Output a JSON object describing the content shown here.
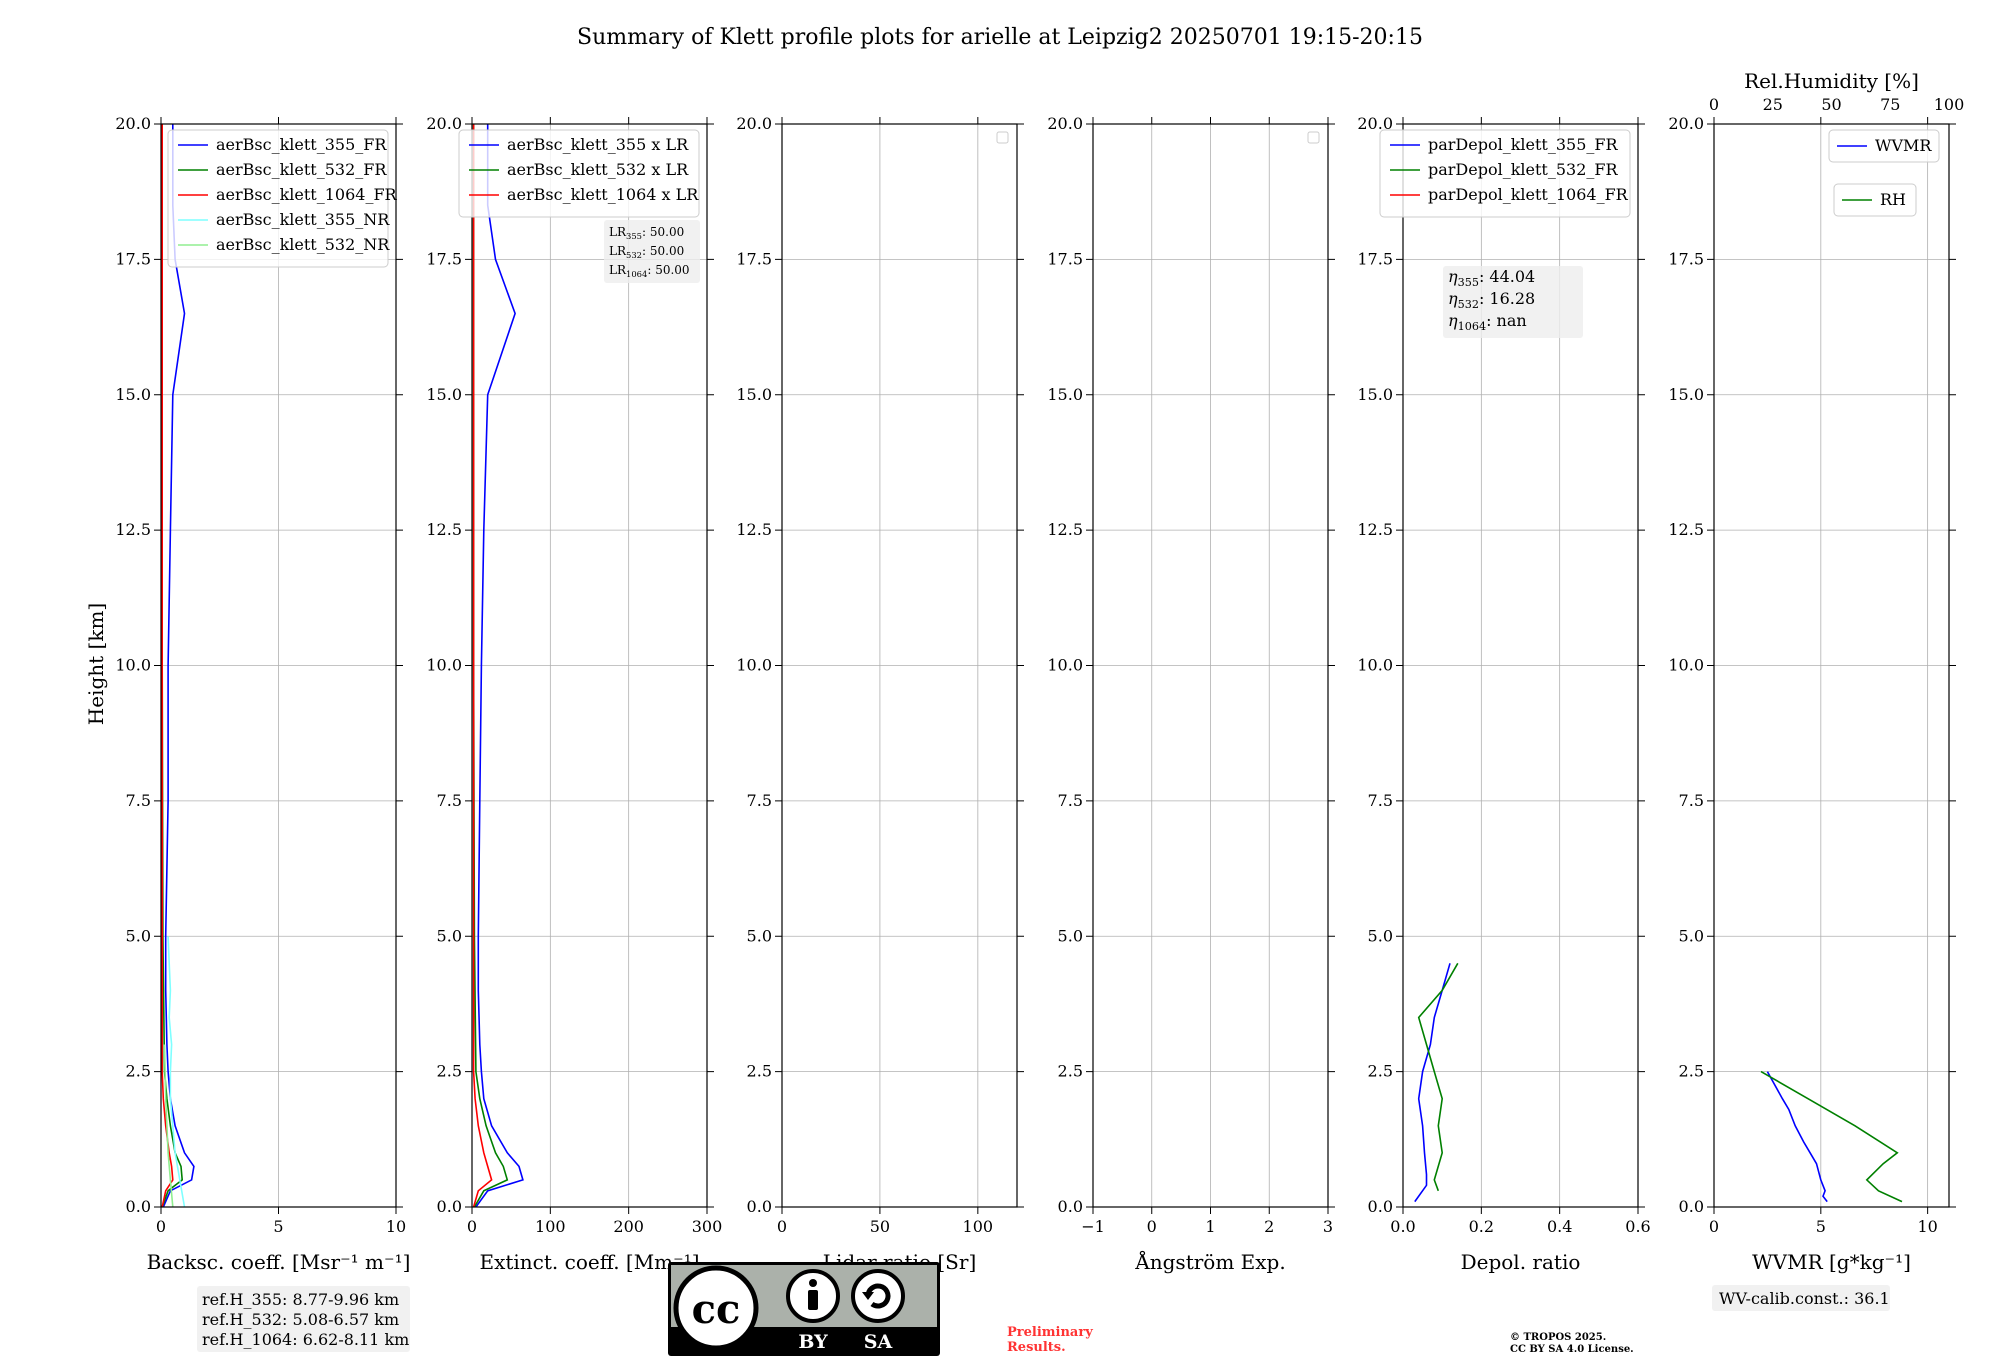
{
  "title": "Summary of Klett profile plots for arielle at Leipzig2 20250701 19:15-20:15",
  "ylabel": "Height [km]",
  "y_ticks": [
    "0.0",
    "2.5",
    "5.0",
    "7.5",
    "10.0",
    "12.5",
    "15.0",
    "17.5",
    "20.0"
  ],
  "colors": {
    "c355": "#0000ff",
    "c532": "#008000",
    "c1064": "#ff0000",
    "c355nr": "#7fffff",
    "c532nr": "#90ee90",
    "wvmr": "#0000ff",
    "rh": "#008000"
  },
  "chart_data": [
    {
      "type": "line",
      "id": "bsc",
      "xlabel": "Backsc. coeff. [Msr⁻¹ m⁻¹]",
      "xlim": [
        0,
        10
      ],
      "ylim": [
        0,
        20
      ],
      "x_ticks": [
        "0",
        "5",
        "10"
      ],
      "legend": "top-right",
      "series": [
        {
          "name": "aerBsc_klett_355_FR",
          "color": "#0000ff",
          "y": [
            0.0,
            0.3,
            0.5,
            0.75,
            1.0,
            1.5,
            2.0,
            2.5,
            3.0,
            4.0,
            5.0,
            7.5,
            10.0,
            12.5,
            15.0,
            16.5,
            17.5,
            18.5,
            20.0
          ],
          "x": [
            0.1,
            0.4,
            1.3,
            1.4,
            1.0,
            0.6,
            0.4,
            0.3,
            0.25,
            0.2,
            0.2,
            0.3,
            0.3,
            0.4,
            0.5,
            1.0,
            0.6,
            0.5,
            0.5
          ]
        },
        {
          "name": "aerBsc_klett_532_FR",
          "color": "#008000",
          "y": [
            0.0,
            0.3,
            0.5,
            0.75,
            1.0,
            1.5,
            2.0,
            2.5,
            5.0,
            10.0,
            15.0,
            20.0
          ],
          "x": [
            0.05,
            0.3,
            0.9,
            0.85,
            0.6,
            0.4,
            0.25,
            0.15,
            0.08,
            0.05,
            0.05,
            0.05
          ]
        },
        {
          "name": "aerBsc_klett_1064_FR",
          "color": "#ff0000",
          "y": [
            0.0,
            0.3,
            0.5,
            0.75,
            1.0,
            1.5,
            2.0,
            2.5,
            5.0,
            10.0,
            15.0,
            20.0
          ],
          "x": [
            0.05,
            0.2,
            0.5,
            0.45,
            0.35,
            0.2,
            0.1,
            0.05,
            0.05,
            0.05,
            0.05,
            0.05
          ]
        },
        {
          "name": "aerBsc_klett_355_NR",
          "color": "#7fffff",
          "y": [
            0.0,
            0.5,
            1.0,
            2.0,
            2.5,
            3.0,
            3.5,
            4.0,
            4.5,
            5.0
          ],
          "x": [
            1.0,
            0.8,
            0.6,
            0.4,
            0.4,
            0.45,
            0.35,
            0.4,
            0.35,
            0.3
          ]
        },
        {
          "name": "aerBsc_klett_532_NR",
          "color": "#90ee90",
          "y": [
            0.0,
            0.5,
            1.0,
            2.0,
            3.0
          ],
          "x": [
            0.5,
            0.4,
            0.3,
            0.2,
            0.15
          ]
        }
      ]
    },
    {
      "type": "line",
      "id": "ext",
      "xlabel": "Extinct. coeff. [Mm⁻¹]",
      "xlim": [
        0,
        300
      ],
      "ylim": [
        0,
        20
      ],
      "x_ticks": [
        "0",
        "100",
        "200",
        "300"
      ],
      "legend": "top-right",
      "series": [
        {
          "name": "aerBsc_klett_355 x LR",
          "color": "#0000ff",
          "y": [
            0.0,
            0.3,
            0.5,
            0.75,
            1.0,
            1.5,
            2.0,
            2.5,
            3.0,
            4.0,
            5.0,
            7.5,
            10.0,
            12.5,
            15.0,
            16.5,
            17.5,
            18.5,
            20.0
          ],
          "x": [
            5,
            20,
            65,
            60,
            45,
            25,
            15,
            12,
            10,
            8,
            8,
            10,
            12,
            15,
            20,
            55,
            30,
            20,
            20
          ]
        },
        {
          "name": "aerBsc_klett_532 x LR",
          "color": "#008000",
          "y": [
            0.0,
            0.3,
            0.5,
            0.75,
            1.0,
            1.5,
            2.0,
            2.5,
            5.0,
            10.0,
            15.0,
            20.0
          ],
          "x": [
            3,
            15,
            45,
            40,
            30,
            18,
            10,
            5,
            3,
            2,
            2,
            2
          ]
        },
        {
          "name": "aerBsc_klett_1064 x LR",
          "color": "#ff0000",
          "y": [
            0.0,
            0.3,
            0.5,
            0.75,
            1.0,
            1.5,
            2.0,
            2.5,
            5.0,
            10.0,
            15.0,
            20.0
          ],
          "x": [
            2,
            8,
            25,
            20,
            15,
            8,
            4,
            2,
            2,
            2,
            2,
            2
          ]
        }
      ],
      "annotation": [
        {
          "label": "LR",
          "sub": "355",
          "value": ": 50.00"
        },
        {
          "label": "LR",
          "sub": "532",
          "value": ": 50.00"
        },
        {
          "label": "LR",
          "sub": "1064",
          "value": ": 50.00"
        }
      ]
    },
    {
      "type": "line",
      "id": "lr",
      "xlabel": "Lidar ratio [Sr]",
      "xlim": [
        0,
        120
      ],
      "ylim": [
        0,
        20
      ],
      "x_ticks": [
        "0",
        "50",
        "100"
      ],
      "series": []
    },
    {
      "type": "line",
      "id": "ang",
      "xlabel": "Ångström Exp.",
      "xlim": [
        -1,
        3
      ],
      "ylim": [
        0,
        20
      ],
      "x_ticks": [
        "−1",
        "0",
        "1",
        "2",
        "3"
      ],
      "series": []
    },
    {
      "type": "line",
      "id": "dep",
      "xlabel": "Depol. ratio",
      "xlim": [
        0,
        0.6
      ],
      "ylim": [
        0,
        20
      ],
      "x_ticks": [
        "0.0",
        "0.2",
        "0.4",
        "0.6"
      ],
      "legend": "top-right",
      "series": [
        {
          "name": "parDepol_klett_355_FR",
          "color": "#0000ff",
          "y": [
            0.1,
            0.4,
            0.6,
            1.0,
            1.5,
            2.0,
            2.5,
            3.0,
            3.5,
            4.0,
            4.5
          ],
          "x": [
            0.03,
            0.06,
            0.06,
            0.055,
            0.05,
            0.04,
            0.05,
            0.07,
            0.08,
            0.1,
            0.12
          ]
        },
        {
          "name": "parDepol_klett_532_FR",
          "color": "#008000",
          "y": [
            0.3,
            0.5,
            1.0,
            1.5,
            2.0,
            2.5,
            3.0,
            3.5,
            4.0,
            4.5
          ],
          "x": [
            0.09,
            0.08,
            0.1,
            0.09,
            0.1,
            0.08,
            0.06,
            0.04,
            0.1,
            0.14
          ]
        },
        {
          "name": "parDepol_klett_1064_FR",
          "color": "#ff0000",
          "y": [],
          "x": []
        }
      ],
      "annotation": [
        {
          "label": "η",
          "sub": "355",
          "value": ": 44.04"
        },
        {
          "label": "η",
          "sub": "532",
          "value": ": 16.28"
        },
        {
          "label": "η",
          "sub": "1064",
          "value": ": nan"
        }
      ]
    },
    {
      "type": "line",
      "id": "wv",
      "xlabel": "WVMR [g*kg⁻¹]",
      "x2label": "Rel.Humidity [%]",
      "xlim": [
        0,
        11
      ],
      "x2lim": [
        0,
        100
      ],
      "ylim": [
        0,
        20
      ],
      "x_ticks": [
        "0",
        "5",
        "10"
      ],
      "x2_ticks": [
        "0",
        "25",
        "50",
        "75",
        "100"
      ],
      "legend": "top-right",
      "series": [
        {
          "name": "WVMR",
          "color": "#0000ff",
          "y": [
            0.1,
            0.2,
            0.3,
            0.5,
            0.8,
            1.0,
            1.2,
            1.5,
            1.8,
            2.0,
            2.5
          ],
          "x": [
            5.3,
            5.1,
            5.2,
            5.0,
            4.8,
            4.5,
            4.2,
            3.8,
            3.5,
            3.2,
            2.5
          ]
        },
        {
          "name": "RH",
          "color": "#008000",
          "y": [
            0.1,
            0.3,
            0.5,
            0.8,
            1.0,
            1.5,
            2.0,
            2.5
          ],
          "x": [
            80,
            70,
            65,
            72,
            78,
            60,
            40,
            20
          ]
        }
      ],
      "annotation": [
        {
          "label": "WV-calib.const.: 36.1",
          "sub": "",
          "value": ""
        }
      ]
    }
  ],
  "ref_heights": [
    "ref.H_355: 8.77-9.96 km",
    "ref.H_532: 5.08-6.57 km",
    "ref.H_1064: 6.62-8.11 km"
  ],
  "license_badge": {
    "cc": "cc",
    "by": "BY",
    "sa": "SA"
  },
  "preliminary": [
    "Preliminary",
    "Results."
  ],
  "copyright": [
    "© TROPOS 2025.",
    "CC BY SA 4.0 License."
  ]
}
